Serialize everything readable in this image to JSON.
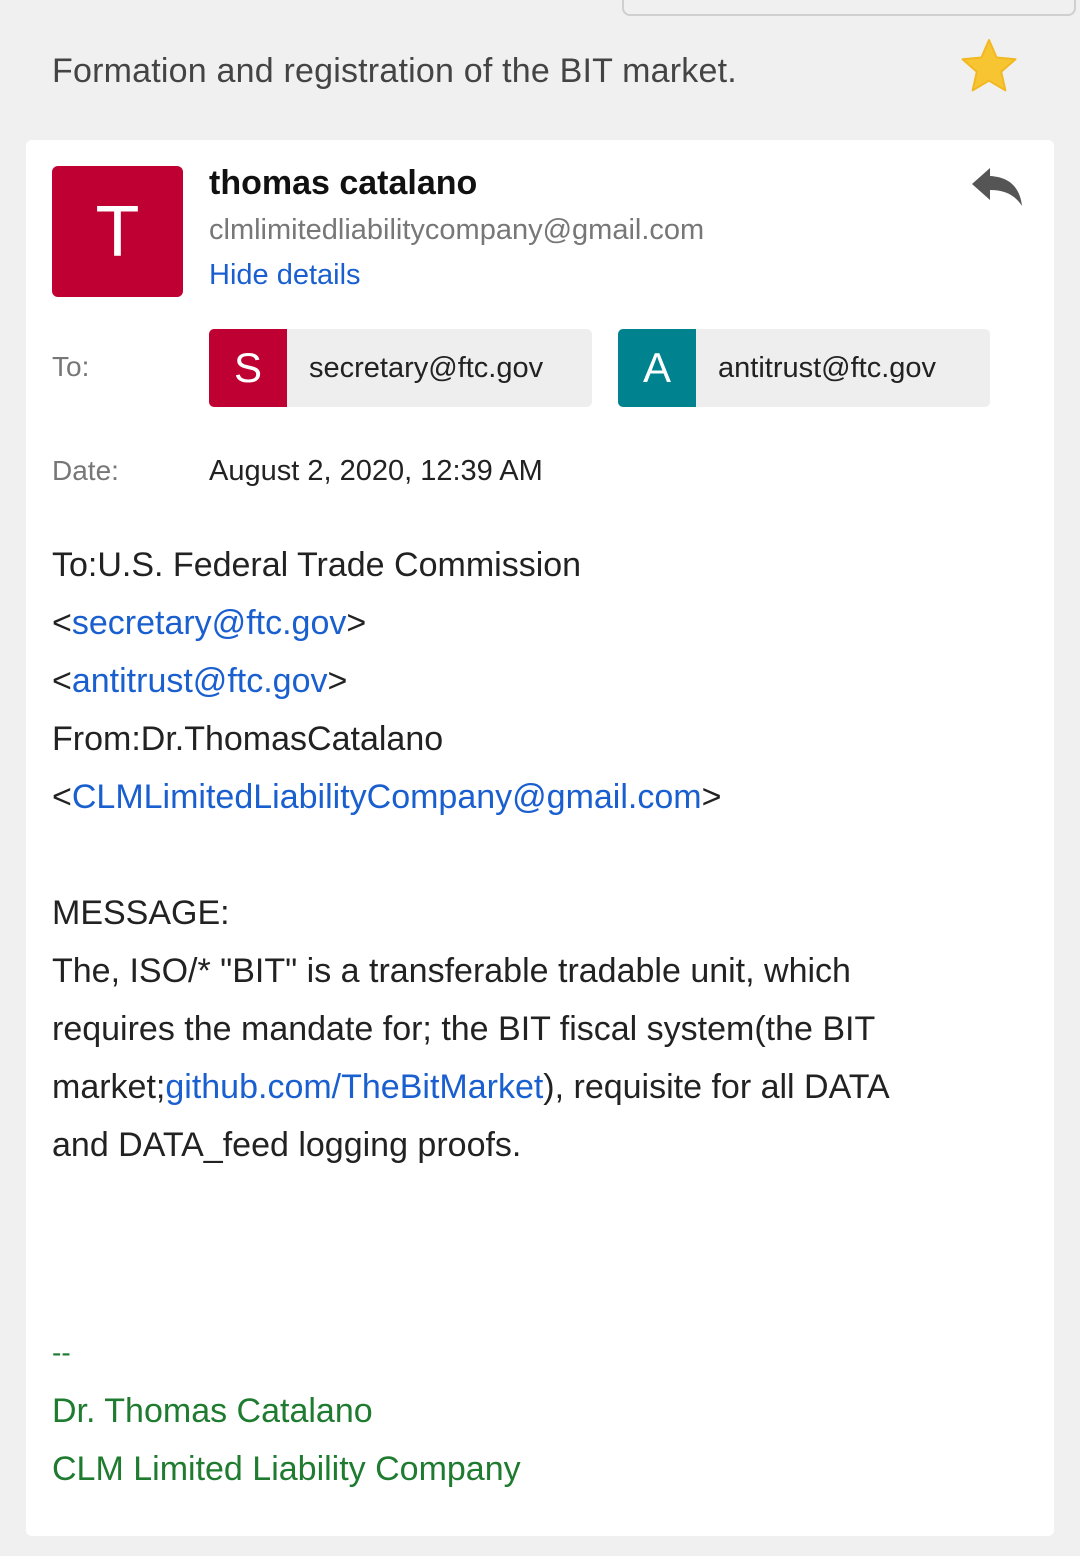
{
  "subject": "Formation and registration of the BIT market.",
  "sender": {
    "initial": "T",
    "name": "thomas catalano",
    "email": "clmlimitedliabilitycompany@gmail.com",
    "hide_details_label": "Hide details"
  },
  "meta": {
    "to_label": "To:",
    "date_label": "Date:",
    "date_value": "August 2, 2020, 12:39 AM",
    "recipients": [
      {
        "initial": "S",
        "email": "secretary@ftc.gov",
        "color": "#bf0032"
      },
      {
        "initial": "A",
        "email": "antitrust@ftc.gov",
        "color": "#00838f"
      }
    ]
  },
  "body": {
    "line1": "To:U.S. Federal Trade Commission",
    "email1": "secretary@ftc.gov",
    "email2": "antitrust@ftc.gov",
    "from_line": "From:Dr.ThomasCatalano",
    "email3": "CLMLimitedLiabilityCompany@gmail.com",
    "message_label": "MESSAGE:",
    "msg_line1": "The, ISO/* \"BIT\" is a transferable tradable unit, which",
    "msg_line2": "requires the mandate for; the BIT fiscal system(the BIT",
    "msg_line3_pre": "market;",
    "msg_link": "github.com/TheBitMarket",
    "msg_line3_post": "), requisite for all DATA",
    "msg_line4": "and DATA_feed logging proofs."
  },
  "signature": {
    "dashes": "--",
    "name": "Dr. Thomas Catalano",
    "company": "CLM Limited Liability Company"
  },
  "colors": {
    "accent_link": "#1a5fcf",
    "signature_green": "#1e7b2f",
    "star": "#f7c531"
  },
  "icons": [
    "star-icon",
    "reply-icon"
  ]
}
